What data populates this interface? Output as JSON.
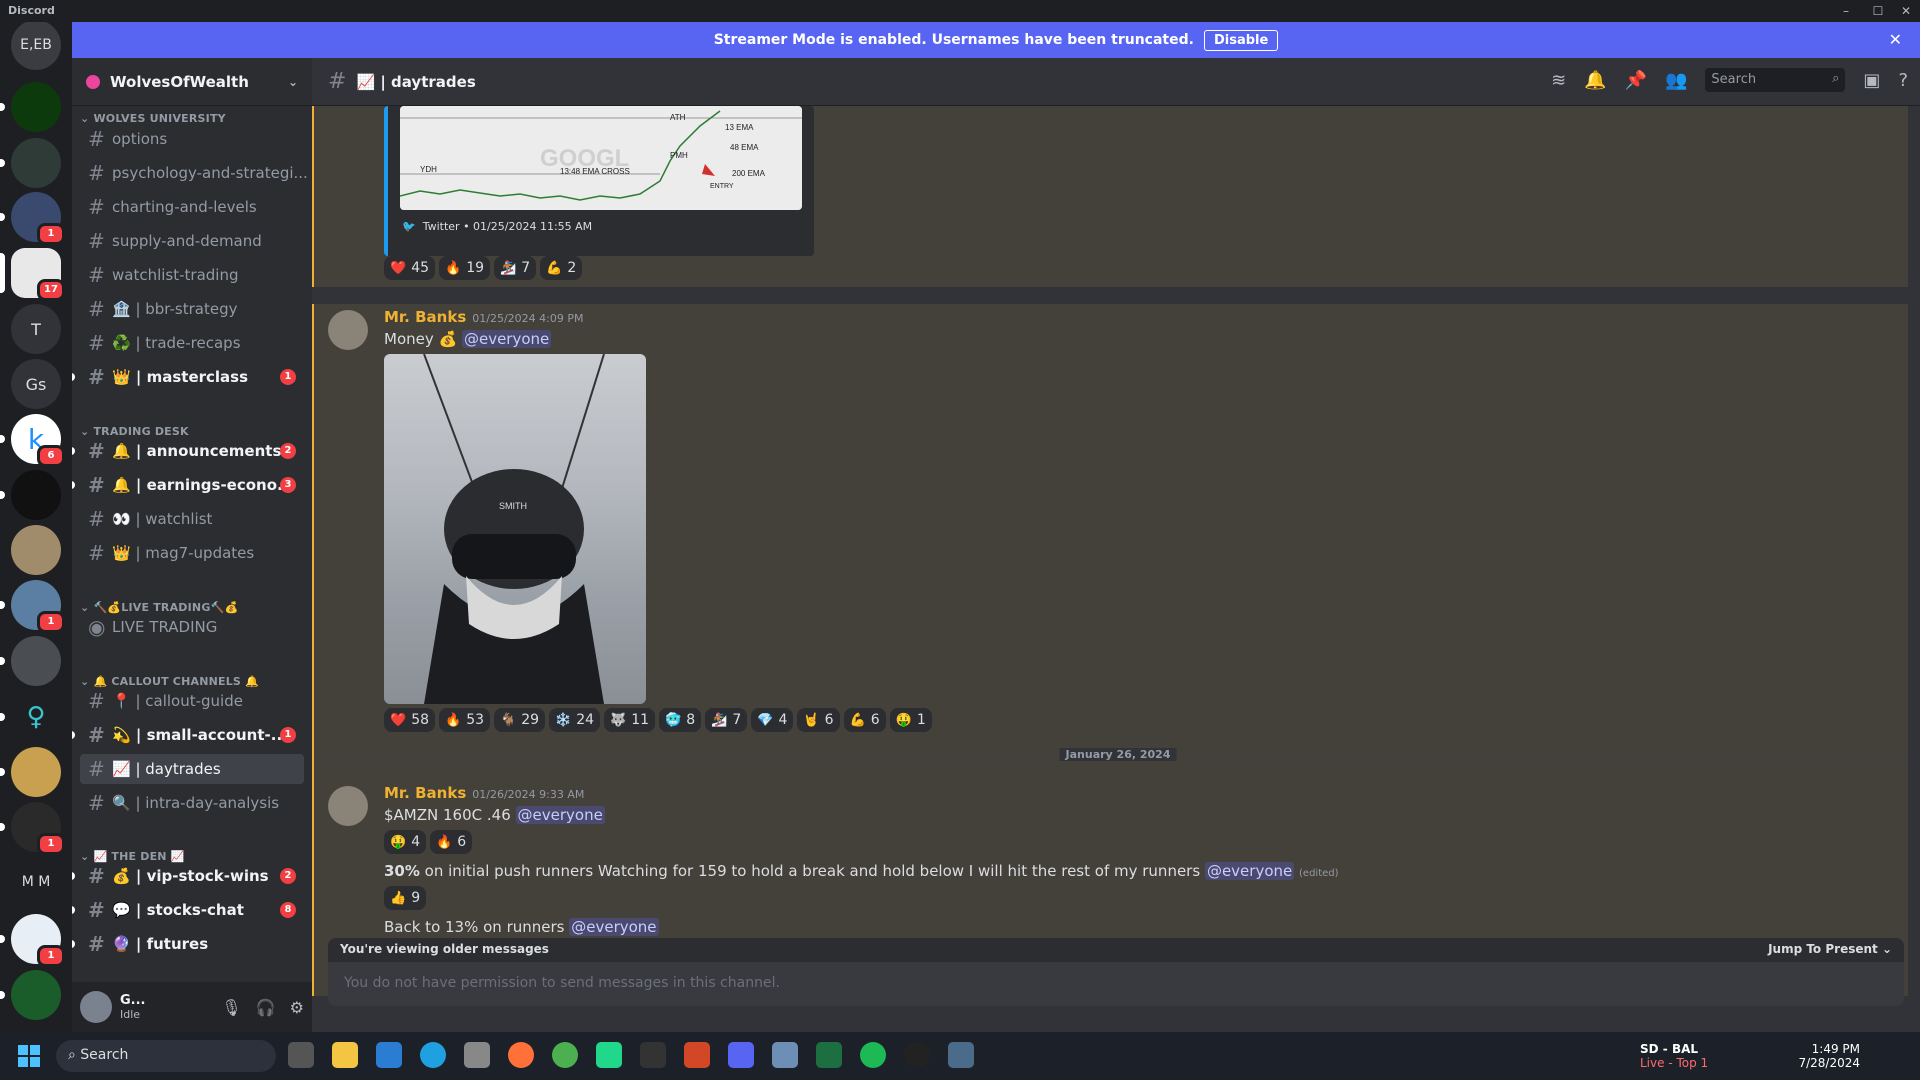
{
  "app": {
    "title": "Discord"
  },
  "banner": {
    "text": "Streamer Mode is enabled. Usernames have been truncated.",
    "button": "Disable"
  },
  "rail": {
    "servers": [
      {
        "label": "E,EB",
        "ping": ""
      },
      {
        "label": "",
        "ping": ""
      },
      {
        "label": "",
        "ping": ""
      },
      {
        "label": "",
        "ping": "1"
      },
      {
        "label": "",
        "ping": "17"
      },
      {
        "label": "T",
        "ping": ""
      },
      {
        "label": "Gs",
        "ping": ""
      },
      {
        "label": "k",
        "ping": "6"
      },
      {
        "label": "",
        "ping": ""
      },
      {
        "label": "",
        "ping": ""
      },
      {
        "label": "",
        "ping": "1"
      },
      {
        "label": "",
        "ping": ""
      },
      {
        "label": "",
        "ping": ""
      },
      {
        "label": "",
        "ping": ""
      },
      {
        "label": "",
        "ping": "1"
      },
      {
        "label": "M M",
        "ping": ""
      },
      {
        "label": "",
        "ping": "1"
      },
      {
        "label": "",
        "ping": ""
      }
    ]
  },
  "guild": {
    "name": "WolvesOfWealth"
  },
  "categories": {
    "c1": "WOLVES UNIVERSITY",
    "c2": "TRADING DESK",
    "c3": "🔨💰LIVE TRADING🔨💰",
    "c4": "🔔 CALLOUT CHANNELS 🔔",
    "c5": "📈 THE DEN 📈"
  },
  "channels": {
    "options": "options",
    "psych": "psychology-and-strategi...",
    "charting": "charting-and-levels",
    "supply": "supply-and-demand",
    "watchlist_trading": "watchlist-trading",
    "bbr": "🏦 | bbr-strategy",
    "recaps": "♻️ | trade-recaps",
    "masterclass": "👑 | masterclass",
    "masterclass_badge": "1",
    "announcements": "🔔 | announcements",
    "announcements_badge": "2",
    "earnings": "🔔 | earnings-econo...",
    "earnings_badge": "3",
    "watchlist": "👀 | watchlist",
    "mag7": "👑 | mag7-updates",
    "live": "LIVE TRADING",
    "callout_guide": "📍 | callout-guide",
    "small_account": "💫 | small-account-...",
    "small_badge": "1",
    "daytrades": "📈 | daytrades",
    "intraday": "🔍 | intra-day-analysis",
    "vip": "💰 | vip-stock-wins",
    "vip_badge": "2",
    "stocks_chat": "💬 | stocks-chat",
    "stocks_badge": "8",
    "futures": "🔮 | futures"
  },
  "user": {
    "name": "G...",
    "status": "Idle"
  },
  "header": {
    "channel": "📈 | daytrades",
    "search_placeholder": "Search"
  },
  "embed": {
    "footer": "Twitter • 01/25/2024 11:55 AM",
    "chart_labels": {
      "ath": "ATH",
      "ema13": "13 EMA",
      "ema48": "48 EMA",
      "ema200": "200 EMA",
      "pmh": "PMH",
      "ydh": "YDH",
      "cross": "13:48 EMA CROSS",
      "entry": "ENTRY",
      "watermark": "GOOGL"
    }
  },
  "reactions_top": [
    {
      "emoji": "❤️",
      "count": "45"
    },
    {
      "emoji": "🔥",
      "count": "19"
    },
    {
      "emoji": "🏂",
      "count": "7"
    },
    {
      "emoji": "💪",
      "count": "2"
    }
  ],
  "msg1": {
    "author": "Mr. Banks",
    "time": "01/25/2024 4:09 PM",
    "text": "Money 💰",
    "mention": "@everyone",
    "photo_text": "SMITH"
  },
  "reactions_mid": [
    {
      "emoji": "❤️",
      "count": "58"
    },
    {
      "emoji": "🔥",
      "count": "53"
    },
    {
      "emoji": "🐐",
      "count": "29"
    },
    {
      "emoji": "❄️",
      "count": "24"
    },
    {
      "emoji": "🐺",
      "count": "11"
    },
    {
      "emoji": "🥶",
      "count": "8"
    },
    {
      "emoji": "🏂",
      "count": "7"
    },
    {
      "emoji": "💎",
      "count": "4"
    },
    {
      "emoji": "🤘",
      "count": "6"
    },
    {
      "emoji": "💪",
      "count": "6"
    },
    {
      "emoji": "🤑",
      "count": "1"
    }
  ],
  "date_divider": "January 26, 2024",
  "msg2": {
    "author": "Mr. Banks",
    "time": "01/26/2024 9:33 AM",
    "line1": "$AMZN 160C .46",
    "mention": "@everyone",
    "reactions1": [
      {
        "emoji": "🤑",
        "count": "4"
      },
      {
        "emoji": "🔥",
        "count": "6"
      }
    ],
    "line2_bold": "30%",
    "line2": " on initial  push runners Watching for 159 to hold a break and hold below I will hit the rest of my runners",
    "edited": "(edited)",
    "reactions2": [
      {
        "emoji": "👍",
        "count": "9"
      }
    ],
    "line3": "Back to 13% on runners"
  },
  "older": {
    "text": "You're viewing older messages",
    "jump": "Jump To Present ⌄"
  },
  "composer": {
    "placeholder": "You do not have permission to send messages in this channel."
  },
  "taskbar": {
    "search": "Search",
    "tray_title": "SD - BAL",
    "tray_sub": "Live - Top 1",
    "time": "1:49 PM",
    "date": "7/28/2024"
  }
}
